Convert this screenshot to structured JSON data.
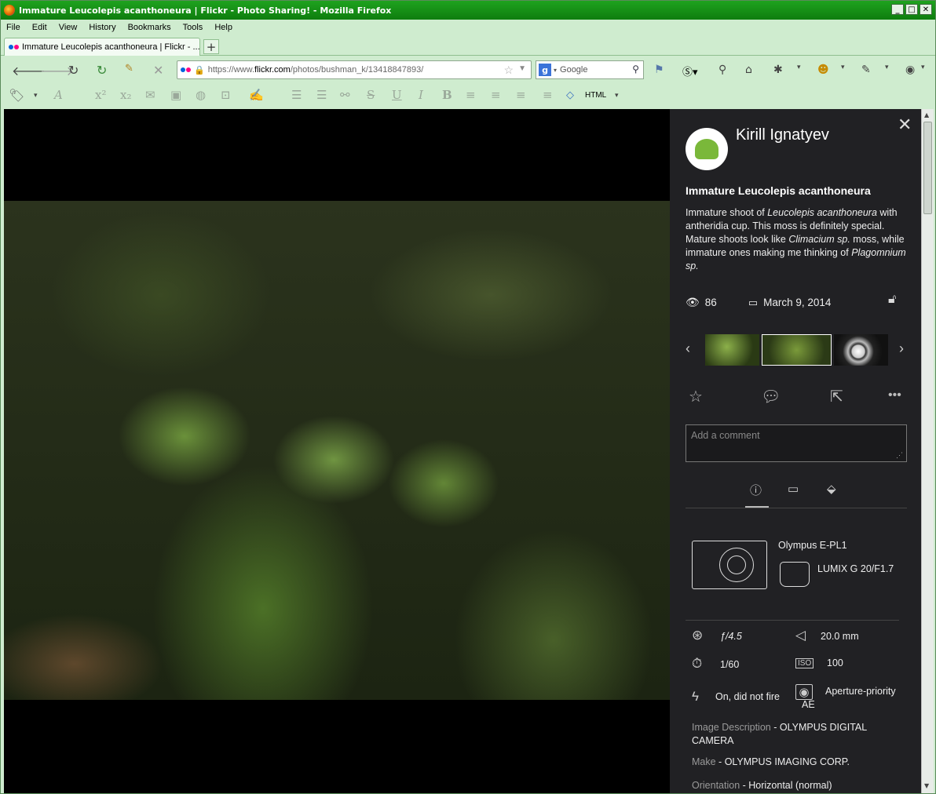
{
  "window": {
    "title": "Immature Leucolepis acanthoneura | Flickr - Photo Sharing! - Mozilla Firefox"
  },
  "menu": [
    "File",
    "Edit",
    "View",
    "History",
    "Bookmarks",
    "Tools",
    "Help"
  ],
  "tab": {
    "title": "Immature Leucolepis acanthoneura | Flickr - ..."
  },
  "nav": {
    "url_prefix": "https://www.",
    "url_domain": "flickr.com",
    "url_path": "/photos/bushman_k/13418847893/",
    "search_placeholder": "Google"
  },
  "format_toolbar": {
    "html_label": "HTML"
  },
  "sidebar": {
    "author": "Kirill Ignatyev",
    "photo_title": "Immature Leucolepis acanthoneura",
    "description_parts": {
      "p1": "Immature shoot of ",
      "i1": "Leucolepis acanthoneura",
      "p2": " with antheridia cup. This moss is definitely special. Mature shoots look like ",
      "i2": "Climacium sp.",
      "p3": " moss, while immature ones making me thinking of ",
      "i3": "Plagomnium sp."
    },
    "views": "86",
    "date": "March 9, 2014",
    "comment_placeholder": "Add a comment",
    "camera": "Olympus E-PL1",
    "lens": "LUMIX G 20/F1.7",
    "exif": {
      "aperture": "ƒ/4.5",
      "focal_length": "20.0 mm",
      "shutter": "1/60",
      "iso_label": "ISO",
      "iso": "100",
      "flash": "On, did not fire",
      "exposure_mode": "Aperture-priority AE"
    },
    "meta": {
      "image_description_key": "Image Description",
      "image_description_val": "OLYMPUS DIGITAL CAMERA",
      "make_key": "Make",
      "make_val": "OLYMPUS IMAGING CORP.",
      "orientation_key": "Orientation",
      "orientation_val": "Horizontal (normal)"
    }
  },
  "colors": {
    "titlebar": "#129212",
    "chrome": "#cfeccf",
    "sidebar_bg": "#212124",
    "flickr_blue": "#0063dc",
    "flickr_pink": "#ff0084"
  }
}
